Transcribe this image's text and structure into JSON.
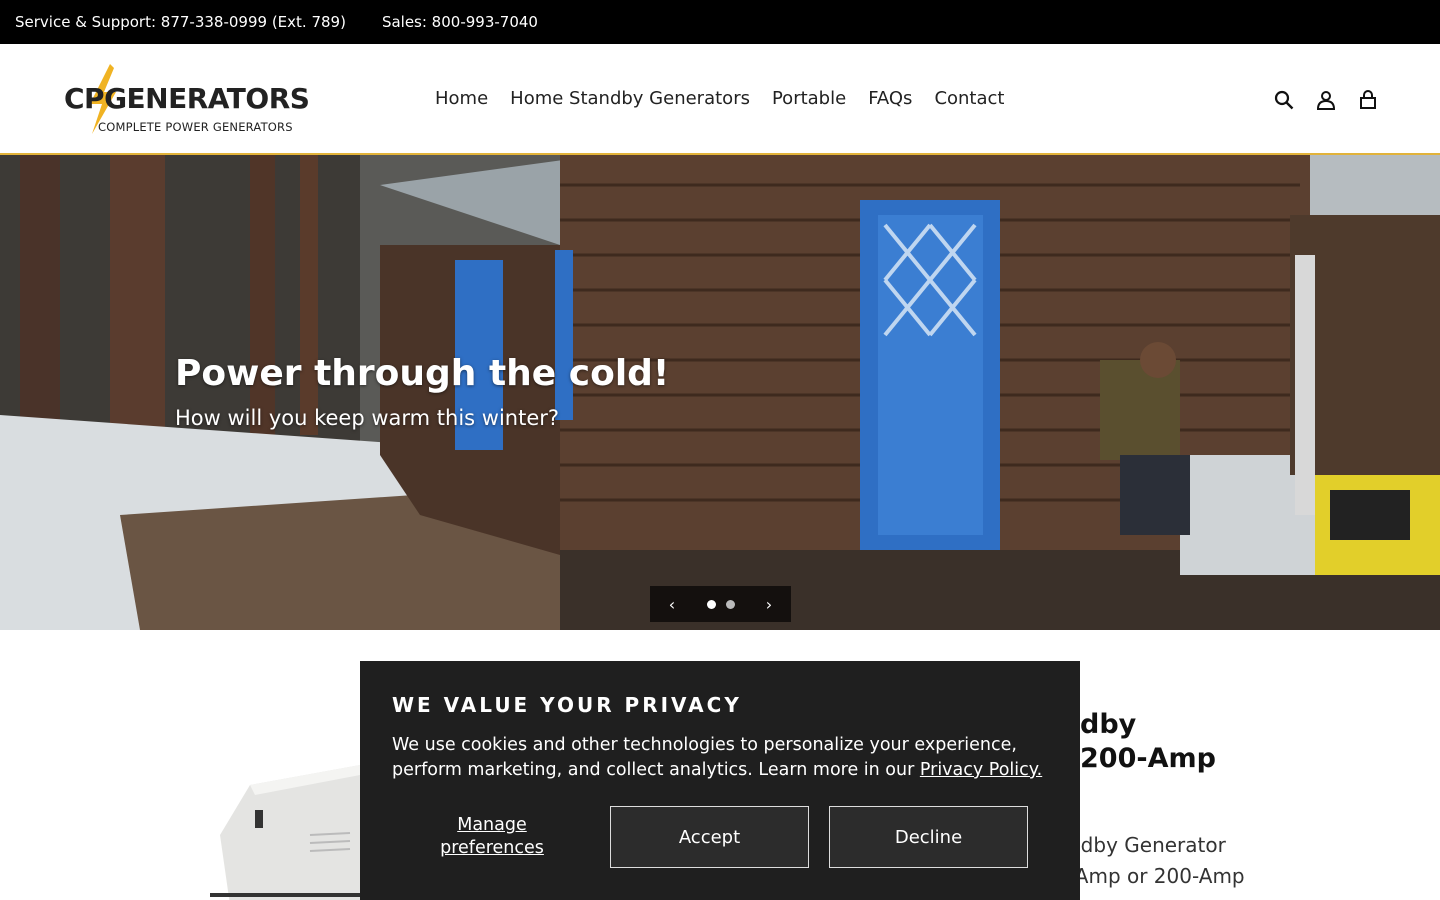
{
  "topbar": {
    "support": "Service & Support: 877-338-0999 (Ext. 789)",
    "sales": "Sales: 800-993-7040"
  },
  "header": {
    "logo_wordmark": "CPGENERATORS",
    "logo_tagline": "COMPLETE POWER GENERATORS",
    "nav": [
      "Home",
      "Home Standby Generators",
      "Portable",
      "FAQs",
      "Contact"
    ],
    "icons": [
      "search-icon",
      "account-icon",
      "cart-icon"
    ],
    "accent_color": "#e2b33a"
  },
  "hero": {
    "title": "Power through the cold!",
    "subtitle": "How will you keep warm this winter?",
    "slides_total": 2,
    "active_slide": 1,
    "prev_icon": "chevron-left-icon",
    "next_icon": "chevron-right-icon"
  },
  "product": {
    "title_line1": "dby",
    "title_line2": "200-Amp",
    "desc_line1": "ndby Generator",
    "desc_line2": "-Amp or 200-Amp"
  },
  "privacy": {
    "heading": "WE VALUE YOUR PRIVACY",
    "body": "We use cookies and other technologies to personalize your experience, perform marketing, and collect analytics. Learn more in our ",
    "link": "Privacy Policy.",
    "manage_line1": "Manage",
    "manage_line2": "preferences",
    "accept": "Accept",
    "decline": "Decline"
  }
}
